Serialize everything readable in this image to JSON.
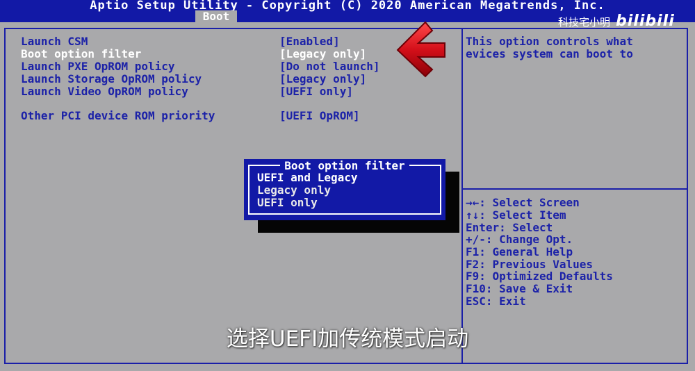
{
  "header": {
    "title": "Aptio Setup Utility - Copyright (C) 2020 American Megatrends, Inc.",
    "active_tab": "Boot"
  },
  "settings": [
    {
      "label": "Launch CSM",
      "value": "[Enabled]"
    },
    {
      "label": "Boot option filter",
      "value": "[Legacy only]"
    },
    {
      "label": "Launch PXE OpROM policy",
      "value": "[Do not launch]"
    },
    {
      "label": "Launch Storage OpROM policy",
      "value": "[Legacy only]"
    },
    {
      "label": "Launch Video OpROM policy",
      "value": "[UEFI only]"
    },
    {
      "label": "Other PCI device ROM priority",
      "value": "[UEFI OpROM]"
    }
  ],
  "help": {
    "line1": "This option controls what",
    "line2": "evices system can boot to"
  },
  "keys": [
    "→←: Select Screen",
    "↑↓: Select Item",
    "Enter: Select",
    "+/-: Change Opt.",
    "F1: General Help",
    "F2: Previous Values",
    "F9: Optimized Defaults",
    "F10: Save & Exit",
    "ESC: Exit"
  ],
  "popup": {
    "title": "Boot option filter",
    "options": [
      "UEFI and Legacy",
      "Legacy only",
      "UEFI only"
    ]
  },
  "watermark": {
    "channel": "科技宅小明",
    "logo": "bilibili"
  },
  "subtitle": "选择UEFI加传统模式启动",
  "colors": {
    "bios_blue": "#1219a6",
    "background_gray": "#a9a9ab",
    "arrow_red": "#d4101a"
  }
}
